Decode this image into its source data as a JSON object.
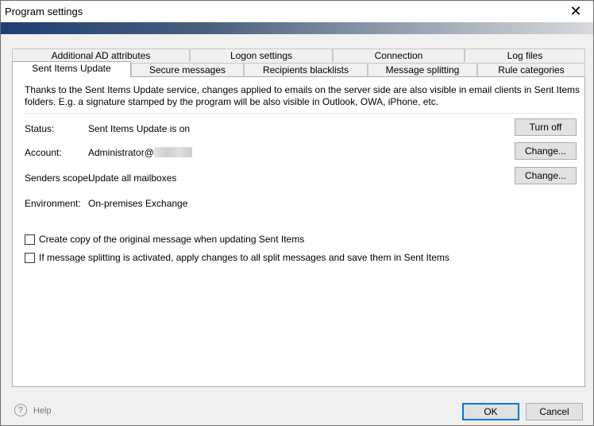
{
  "window": {
    "title": "Program settings",
    "close_glyph": "✕"
  },
  "tabs_row1": [
    {
      "label": "Additional AD attributes"
    },
    {
      "label": "Logon settings"
    },
    {
      "label": "Connection"
    },
    {
      "label": "Log files"
    }
  ],
  "tabs_row2": [
    {
      "label": "Sent Items Update",
      "active": true
    },
    {
      "label": "Secure messages"
    },
    {
      "label": "Recipients blacklists"
    },
    {
      "label": "Message splitting"
    },
    {
      "label": "Rule categories"
    }
  ],
  "panel": {
    "info_text": "Thanks to the Sent Items Update service, changes applied to emails on the server side are also visible in email clients in Sent Items folders. E.g. a signature stamped by the program will be also visible in Outlook, OWA, iPhone, etc.",
    "status_label": "Status:",
    "status_value": "Sent Items Update is on",
    "account_label": "Account:",
    "account_value": "Administrator@",
    "scope_label": "Senders scope:",
    "scope_value": "Update all mailboxes",
    "env_label": "Environment:",
    "env_value": "On-premises Exchange",
    "turn_off_label": "Turn off",
    "change_account_label": "Change...",
    "change_scope_label": "Change...",
    "checkbox1_label": "Create copy of the original message when updating Sent Items",
    "checkbox1_checked": false,
    "checkbox2_label": "If message splitting is activated, apply changes to all split messages and save them in Sent Items",
    "checkbox2_checked": false
  },
  "footer": {
    "help_label": "Help",
    "help_icon": "question-icon",
    "ok_label": "OK",
    "cancel_label": "Cancel"
  }
}
